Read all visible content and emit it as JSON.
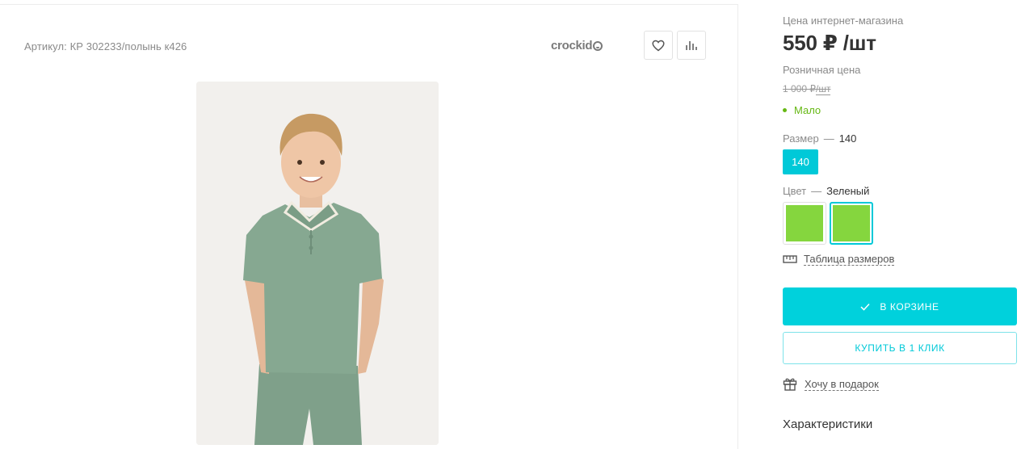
{
  "product": {
    "sku": "Артикул: КР 302233/полынь к426",
    "brand": "crockid"
  },
  "pricing": {
    "online_label": "Цена интернет-магазина",
    "online_price": "550 ₽ /шт",
    "retail_label": "Розничная цена",
    "retail_price": "1 000 ₽",
    "retail_unit": "/шт",
    "stock": "Мало"
  },
  "size": {
    "label": "Размер",
    "dash": "—",
    "selected": "140",
    "options": [
      "140"
    ]
  },
  "color": {
    "label": "Цвет",
    "dash": "—",
    "selected": "Зеленый",
    "swatch_hex": "#85d63e"
  },
  "links": {
    "size_table": "Таблица размеров",
    "gift": "Хочу в подарок"
  },
  "actions": {
    "in_cart": "В КОРЗИНЕ",
    "buy_one_click": "КУПИТЬ В 1 КЛИК"
  },
  "sections": {
    "characteristics": "Характеристики"
  },
  "colors": {
    "accent": "#00d1dc",
    "stock_green": "#66b814"
  }
}
